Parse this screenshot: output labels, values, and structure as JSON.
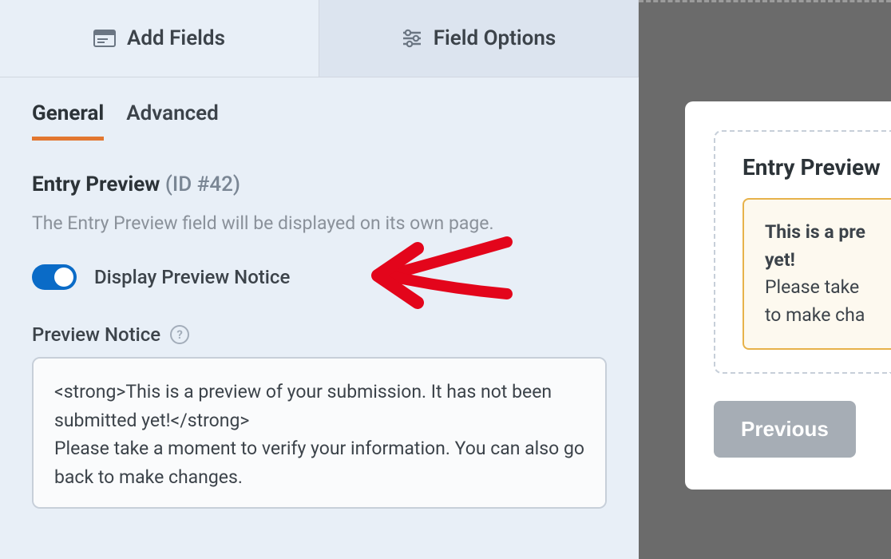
{
  "topTabs": {
    "addFields": "Add Fields",
    "fieldOptions": "Field Options"
  },
  "subTabs": {
    "general": "General",
    "advanced": "Advanced"
  },
  "field": {
    "title": "Entry Preview",
    "id": "(ID #42)",
    "description": "The Entry Preview field will be displayed on its own page.",
    "toggleLabel": "Display Preview Notice",
    "noticeLabel": "Preview Notice",
    "noticeValue": "<strong>This is a preview of your submission. It has not been submitted yet!</strong>\nPlease take a moment to verify your information. You can also go back to make changes."
  },
  "preview": {
    "heading": "Entry Preview",
    "noticeBold1": "This is a pre",
    "noticeBold2": "yet!",
    "noticeLine1": "Please take",
    "noticeLine2": "to make cha",
    "prevButton": "Previous"
  }
}
